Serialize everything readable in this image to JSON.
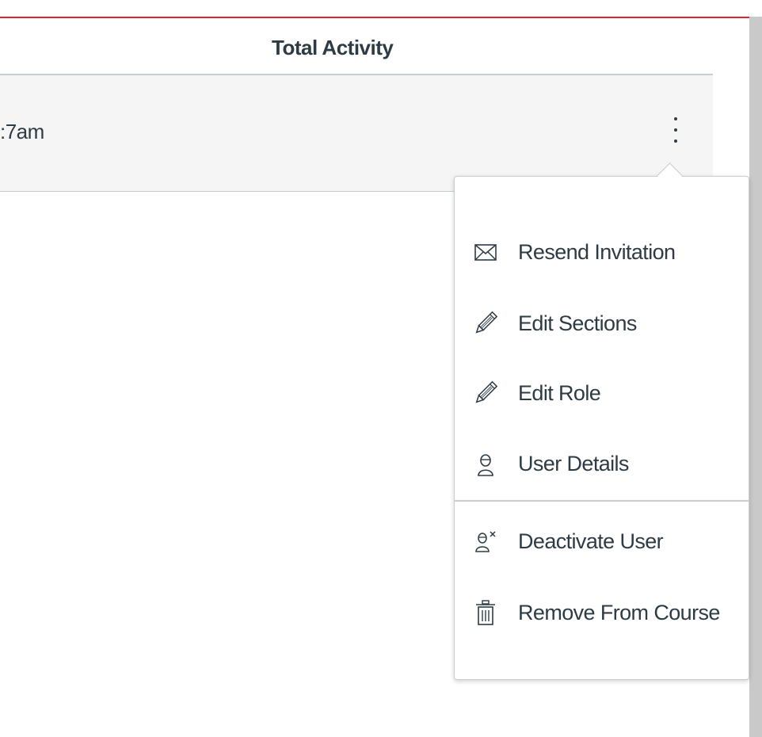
{
  "header": {
    "column_title": "Total Activity"
  },
  "row": {
    "last_activity_partial": ":7am"
  },
  "menu": {
    "items": [
      {
        "label": "Resend Invitation",
        "icon": "envelope-icon"
      },
      {
        "label": "Edit Sections",
        "icon": "pencil-icon"
      },
      {
        "label": "Edit Role",
        "icon": "pencil-icon"
      },
      {
        "label": "User Details",
        "icon": "user-icon"
      },
      {
        "label": "Deactivate User",
        "icon": "deactivate-user-icon"
      },
      {
        "label": "Remove From Course",
        "icon": "trash-icon"
      }
    ]
  },
  "colors": {
    "accent_line": "#e0242a",
    "text": "#2d3b45",
    "row_bg": "#f5f5f5",
    "border": "#c7cdd1"
  }
}
